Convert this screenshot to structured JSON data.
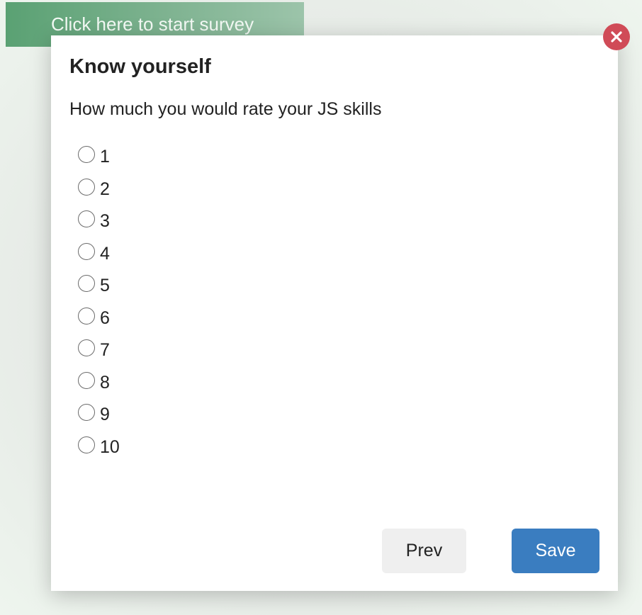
{
  "start_survey": {
    "label": "Click here to start survey"
  },
  "modal": {
    "title": "Know yourself",
    "question": "How much you would rate your JS skills",
    "options": [
      "1",
      "2",
      "3",
      "4",
      "5",
      "6",
      "7",
      "8",
      "9",
      "10"
    ],
    "prev_label": "Prev",
    "save_label": "Save",
    "close_icon": "close-icon"
  },
  "colors": {
    "start_button": "#5aa173",
    "close_button": "#d04b57",
    "save_button": "#3a7dc0",
    "prev_button": "#efefef"
  }
}
